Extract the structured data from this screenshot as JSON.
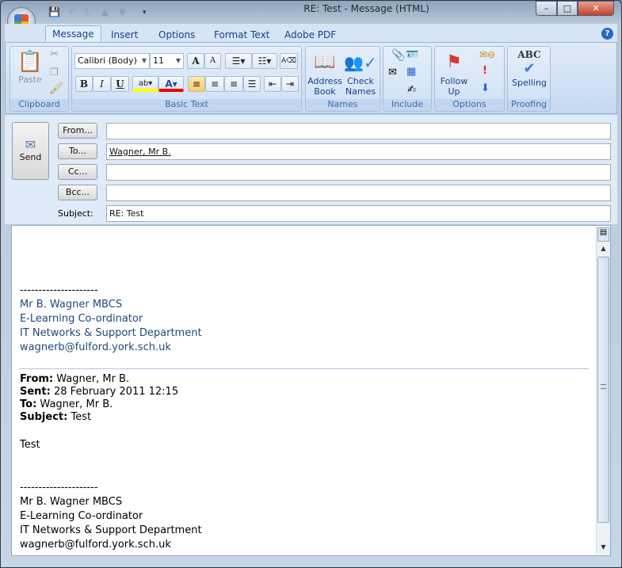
{
  "window": {
    "title": "RE: Test - Message (HTML)",
    "minimize": "–",
    "maximize": "□",
    "close": "✕"
  },
  "qat": {
    "icons": [
      "save-icon",
      "undo-icon",
      "redo-icon",
      "up-icon",
      "down-icon",
      "customize-icon"
    ]
  },
  "tabs": [
    {
      "label": "Message",
      "active": true
    },
    {
      "label": "Insert"
    },
    {
      "label": "Options"
    },
    {
      "label": "Format Text"
    },
    {
      "label": "Adobe PDF"
    }
  ],
  "ribbon": {
    "clipboard": {
      "label": "Clipboard",
      "paste": "Paste"
    },
    "basic_text": {
      "label": "Basic Text",
      "font": "Calibri (Body)",
      "size": "11",
      "bold": "B",
      "italic": "I",
      "underline": "U",
      "highlight_color": "#ffff00",
      "font_color": "#ff0000"
    },
    "names": {
      "label": "Names",
      "address_book": "Address Book",
      "check_names": "Check Names"
    },
    "include": {
      "label": "Include"
    },
    "options": {
      "label": "Options",
      "follow_up": "Follow Up"
    },
    "proofing": {
      "label": "Proofing",
      "spelling": "Spelling",
      "abc": "ABC"
    }
  },
  "header": {
    "send": "Send",
    "from_btn": "From...",
    "to_btn": "To...",
    "cc_btn": "Cc...",
    "bcc_btn": "Bcc...",
    "subject_label": "Subject:",
    "from": "",
    "to": "Wagner, Mr B.",
    "cc": "",
    "bcc": "",
    "subject": "RE: Test"
  },
  "body": {
    "sig_sep": "---------------------",
    "sig": [
      "Mr B. Wagner MBCS",
      "E-Learning Co-ordinator",
      "IT Networks & Support Department",
      "wagnerb@fulford.york.sch.uk"
    ],
    "quote": {
      "from_label": "From:",
      "from": "Wagner, Mr B.",
      "sent_label": "Sent:",
      "sent": "28 February 2011 12:15",
      "to_label": "To:",
      "to": "Wagner, Mr B.",
      "subject_label": "Subject:",
      "subject": "Test"
    },
    "message": "Test",
    "sig2_sep": "---------------------",
    "sig2": [
      "Mr B. Wagner MBCS",
      "E-Learning Co-ordinator",
      "IT Networks & Support Department",
      "wagnerb@fulford.york.sch.uk"
    ]
  },
  "colors": {
    "signature": "#1f497d",
    "ribbon_text": "#15428b"
  }
}
